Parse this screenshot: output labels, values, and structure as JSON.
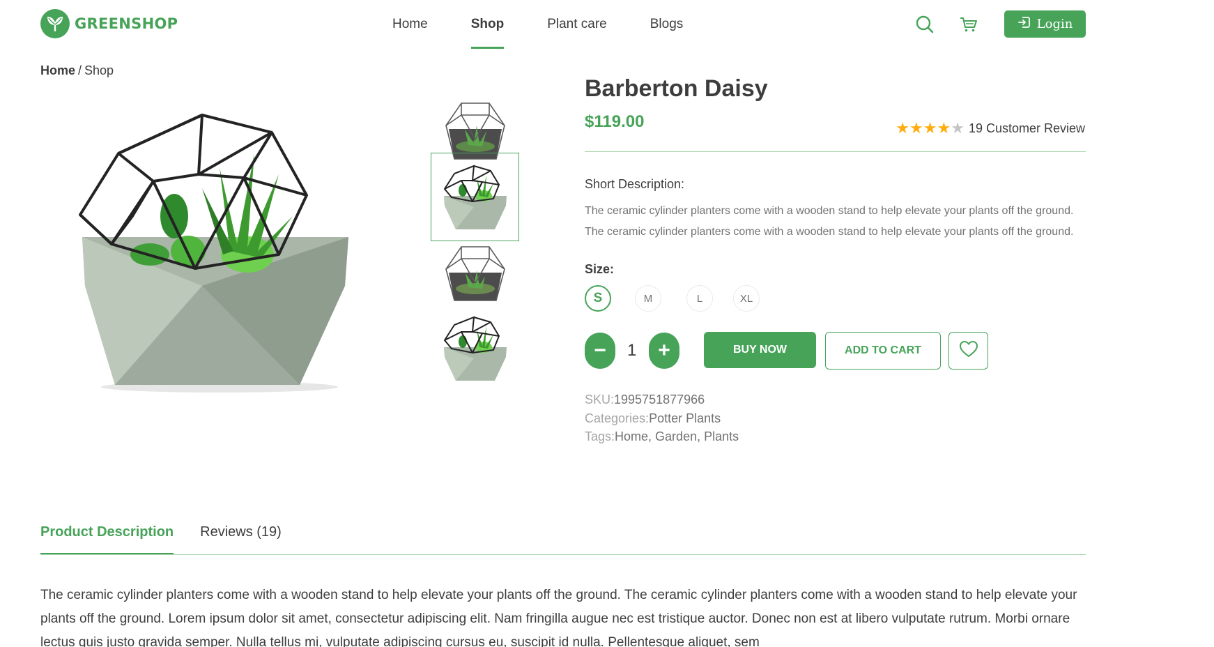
{
  "brand": {
    "name": "GREENSHOP"
  },
  "nav": {
    "items": [
      {
        "label": "Home",
        "active": false
      },
      {
        "label": "Shop",
        "active": true
      },
      {
        "label": "Plant care",
        "active": false
      },
      {
        "label": "Blogs",
        "active": false
      }
    ]
  },
  "header": {
    "login_label": "Login"
  },
  "breadcrumb": {
    "root": "Home",
    "separator": "/",
    "current": "Shop"
  },
  "product": {
    "title": "Barberton Daisy",
    "price": "$119.00",
    "rating": {
      "stars": 4,
      "max": 5
    },
    "review_text": "19 Customer Review",
    "short_description_label": "Short Description:",
    "short_description": "The ceramic cylinder planters come with a wooden stand to help elevate your plants off the ground. The ceramic cylinder planters come with a wooden stand to help elevate your plants off the ground.",
    "size_label": "Size:",
    "sizes": [
      "S",
      "M",
      "L",
      "XL"
    ],
    "selected_size": "S",
    "quantity": "1",
    "qty_minus": "−",
    "qty_plus": "+",
    "buy_now_label": "BUY NOW",
    "add_to_cart_label": "ADD TO CART",
    "sku_label": "SKU:",
    "sku": "1995751877966",
    "categories_label": "Categories:",
    "categories": "Potter Plants",
    "tags_label": "Tags:",
    "tags": "Home, Garden, Plants"
  },
  "tabs": [
    {
      "label": "Product Description",
      "active": true
    },
    {
      "label": "Reviews (19)",
      "active": false
    }
  ],
  "description": "The ceramic cylinder planters come with a wooden stand to help elevate your plants off the ground. The ceramic cylinder planters come with a wooden stand to help elevate your plants off the ground. Lorem ipsum dolor sit amet, consectetur adipiscing elit. Nam fringilla augue nec est tristique auctor. Donec non est at libero vulputate rutrum. Morbi ornare lectus quis justo gravida semper. Nulla tellus mi, vulputate adipiscing cursus eu, suscipit id nulla. Pellentesque aliquet, sem",
  "colors": {
    "accent": "#46a358",
    "star": "#ffac0c",
    "text": "#3d3d3d",
    "muted": "#727272"
  },
  "icons": [
    "leaf-logo-icon",
    "search-icon",
    "cart-icon",
    "login-icon",
    "heart-icon",
    "star-icon"
  ]
}
